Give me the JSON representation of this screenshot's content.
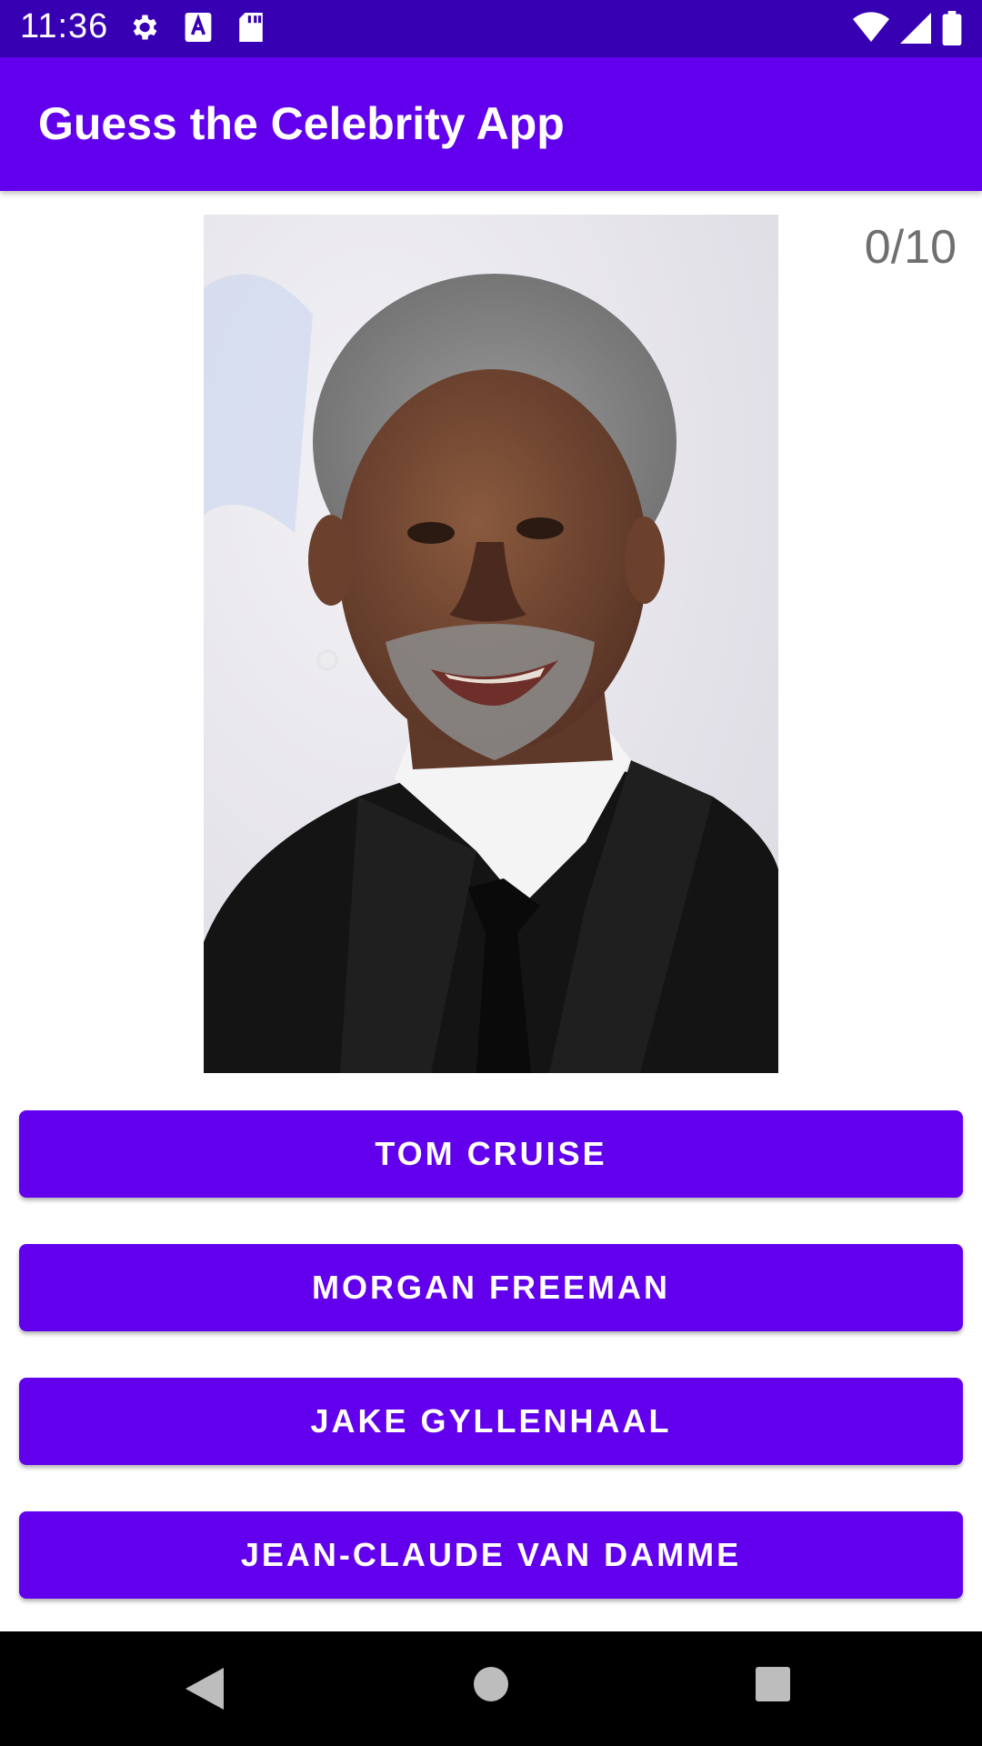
{
  "status_bar": {
    "time": "11:36",
    "left_icons": [
      "gear-icon",
      "text-a-icon",
      "sd-card-icon"
    ],
    "right_icons": [
      "wifi-icon",
      "signal-icon",
      "battery-icon"
    ],
    "background": "#3700b3"
  },
  "app_bar": {
    "title": "Guess the Celebrity App",
    "background": "#6200ee"
  },
  "score": {
    "text": "0/10"
  },
  "answers": [
    {
      "label": "TOM CRUISE"
    },
    {
      "label": "MORGAN FREEMAN"
    },
    {
      "label": "JAKE GYLLENHAAL"
    },
    {
      "label": "JEAN-CLAUDE VAN DAMME"
    }
  ],
  "colors": {
    "button": "#6200ee",
    "button_text": "#ffffff",
    "score_text": "#6f6f6f"
  },
  "nav_bar": {
    "icons": [
      "back-icon",
      "home-icon",
      "recents-icon"
    ]
  }
}
